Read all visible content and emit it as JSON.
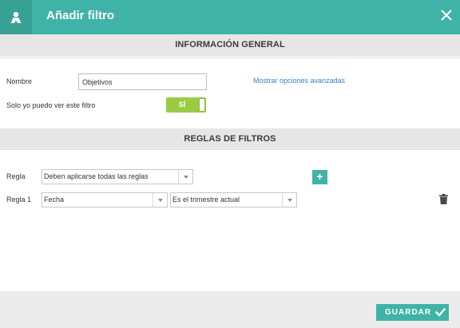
{
  "header": {
    "title": "Añadir filtro",
    "icon": "user-filter-icon",
    "close_icon": "close-icon",
    "bg_color": "#3fb3a7"
  },
  "general": {
    "section_title": "INFORMACIÓN GENERAL",
    "name_label": "Nombre",
    "name_value": "Objetivos",
    "advanced_link": "Mostrar opciones avanzadas",
    "private_label": "Solo yo puedo ver este filtro",
    "private_toggle": {
      "text": "SÍ",
      "on": true,
      "color": "#9bcb45"
    }
  },
  "rules": {
    "section_title": "REGLAS DE FILTROS",
    "rule_label": "Regla",
    "rule_mode": "Deben aplicarse todas las reglas",
    "add_icon": "+",
    "items": [
      {
        "label": "Regla 1",
        "field": "Fecha",
        "condition": "Es el trimestre actual",
        "delete_icon": "trash-icon"
      }
    ]
  },
  "footer": {
    "save_label": "GUARDAR",
    "save_icon": "check-icon"
  }
}
